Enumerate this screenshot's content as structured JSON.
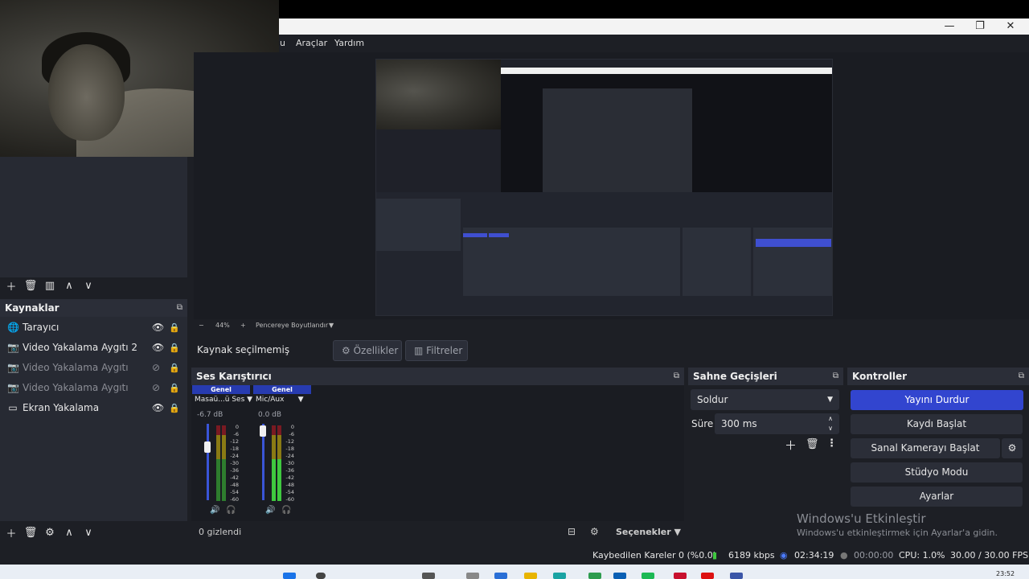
{
  "window": {
    "minimize": "—",
    "maximize": "❐",
    "close": "✕"
  },
  "menu": {
    "partial": "u",
    "tools": "Araçlar",
    "help": "Yardım"
  },
  "sources": {
    "title": "Kaynaklar",
    "items": [
      {
        "label": "Tarayıcı",
        "icon": "globe-icon",
        "visible": true
      },
      {
        "label": "Video Yakalama Aygıtı 2",
        "icon": "camera-icon",
        "visible": true
      },
      {
        "label": "Video Yakalama Aygıtı",
        "icon": "camera-icon",
        "visible": false
      },
      {
        "label": "Video Yakalama Aygıtı",
        "icon": "camera-icon",
        "visible": false
      },
      {
        "label": "Ekran Yakalama",
        "icon": "monitor-icon",
        "visible": true
      }
    ]
  },
  "preview_toolbar": {
    "minus": "−",
    "zoom": "44%",
    "plus": "+",
    "fit": "Pencereye Boyutlandır"
  },
  "context": {
    "no_source": "Kaynak seçilmemiş",
    "properties": "Özellikler",
    "filters": "Filtreler"
  },
  "mixer": {
    "title": "Ses Karıştırıcı",
    "channels": [
      {
        "group": "Genel",
        "name": "Masaü...ü Ses",
        "db": "-6.7 dB",
        "level": 0.55
      },
      {
        "group": "Genel",
        "name": "Mic/Aux",
        "db": "0.0 dB",
        "level": 0.3
      }
    ],
    "scale": [
      "0",
      "-6",
      "-12",
      "-18",
      "-24",
      "-30",
      "-36",
      "-42",
      "-48",
      "-54",
      "-60"
    ],
    "hidden": "0 gizlendi",
    "options": "Seçenekler"
  },
  "transitions": {
    "title": "Sahne Geçişleri",
    "selected": "Soldur",
    "duration_label": "Süre",
    "duration": "300 ms"
  },
  "controls": {
    "title": "Kontroller",
    "stop_stream": "Yayını Durdur",
    "start_record": "Kaydı Başlat",
    "virtual_cam": "Sanal Kamerayı Başlat",
    "studio_mode": "Stüdyo Modu",
    "settings": "Ayarlar"
  },
  "watermark": {
    "line1": "Windows'u Etkinleştir",
    "line2": "Windows'u etkinleştirmek için Ayarlar'a gidin."
  },
  "status": {
    "dropped": "Kaybedilen Kareler 0 (%0.0)",
    "bitrate": "6189 kbps",
    "stream_time": "02:34:19",
    "record_time": "00:00:00",
    "cpu": "CPU: 1.0%",
    "fps": "30.00 / 30.00 FPS"
  },
  "clock": "23:52",
  "colors": {
    "accent": "#3245cf",
    "panel": "#272a33",
    "bg": "#1d1f25"
  }
}
